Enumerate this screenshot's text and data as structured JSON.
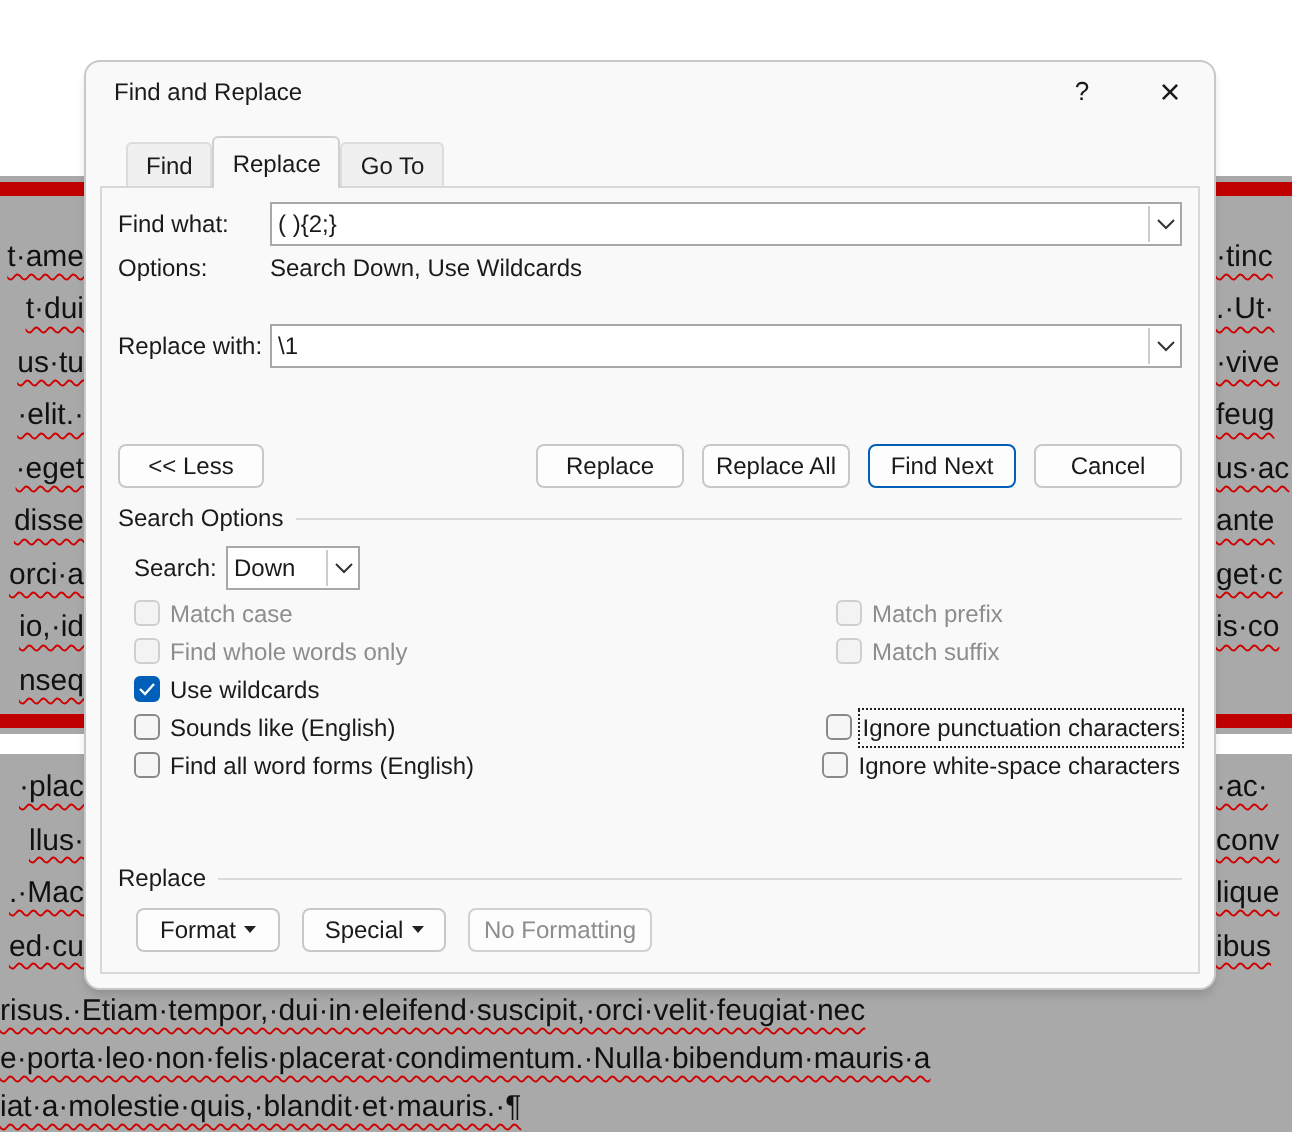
{
  "document": {
    "upper_rows": [
      {
        "left": "t·ame",
        "right": "·tinc"
      },
      {
        "left": "t·dui",
        "right": ".·Ut·"
      },
      {
        "left": "us·tu",
        "right": "·vive"
      },
      {
        "left": "·elit.·",
        "right": "feug"
      },
      {
        "left": "·eget",
        "right": "us·ac"
      },
      {
        "left": "disse",
        "right": "ante"
      },
      {
        "left": "orci·a",
        "right": "get·c"
      },
      {
        "left": "io,·id",
        "right": "is·co"
      },
      {
        "left": "nseq"
      }
    ],
    "lower_rows": [
      {
        "left": "·plac",
        "right": "·ac·"
      },
      {
        "left": "llus·",
        "right": "conv"
      },
      {
        "left": ".·Mac",
        "right": "lique"
      },
      {
        "left": "ed·cu",
        "right": "ibus"
      }
    ],
    "full_lines": [
      "risus.·Etiam·tempor,·dui·in·eleifend·suscipit,·orci·velit·feugiat·nec",
      "e·porta·leo·non·felis·placerat·condimentum.·Nulla·bibendum·mauris·a",
      "iat·a·molestie·quis,·blandit·et·mauris.·¶"
    ]
  },
  "dialog": {
    "title": "Find and Replace",
    "help": "?",
    "close": "×",
    "tabs": [
      {
        "label": "Find",
        "selected": false
      },
      {
        "label": "Replace",
        "selected": true
      },
      {
        "label": "Go To",
        "selected": false
      }
    ],
    "find_what": {
      "label": "Find what:",
      "value": "( ){2;}"
    },
    "options": {
      "label": "Options:",
      "value": "Search Down, Use Wildcards"
    },
    "replace_with": {
      "label": "Replace with:",
      "value": "\\1"
    },
    "less_button": {
      "label": "<< Less"
    },
    "action_buttons": [
      {
        "label": "Replace",
        "default": false
      },
      {
        "label": "Replace All",
        "default": false
      },
      {
        "label": "Find Next",
        "default": true
      },
      {
        "label": "Cancel",
        "default": false
      }
    ],
    "search_options": {
      "heading": "Search Options",
      "search_label": "Search:",
      "search_value": "Down",
      "checkbox_rows": [
        {
          "left": {
            "label": "Match case",
            "checked": false,
            "disabled": true,
            "focused": false
          },
          "right": {
            "label": "Match prefix",
            "checked": false,
            "disabled": true,
            "focused": false
          }
        },
        {
          "left": {
            "label": "Find whole words only",
            "checked": false,
            "disabled": true,
            "focused": false
          },
          "right": {
            "label": "Match suffix",
            "checked": false,
            "disabled": true,
            "focused": false
          }
        },
        {
          "left": {
            "label": "Use wildcards",
            "checked": true,
            "disabled": false,
            "focused": false
          }
        },
        {
          "left": {
            "label": "Sounds like (English)",
            "checked": false,
            "disabled": false,
            "focused": false
          },
          "right": {
            "label": "Ignore punctuation characters",
            "checked": false,
            "disabled": false,
            "focused": true
          }
        },
        {
          "left": {
            "label": "Find all word forms (English)",
            "checked": false,
            "disabled": false,
            "focused": false
          },
          "right": {
            "label": "Ignore white-space characters",
            "checked": false,
            "disabled": false,
            "focused": false
          }
        }
      ]
    },
    "replace_section": {
      "heading": "Replace",
      "buttons": [
        {
          "label": "Format",
          "dropdown": true,
          "disabled": false
        },
        {
          "label": "Special",
          "dropdown": true,
          "disabled": false
        },
        {
          "label": "No Formatting",
          "dropdown": false,
          "disabled": true
        }
      ]
    }
  }
}
